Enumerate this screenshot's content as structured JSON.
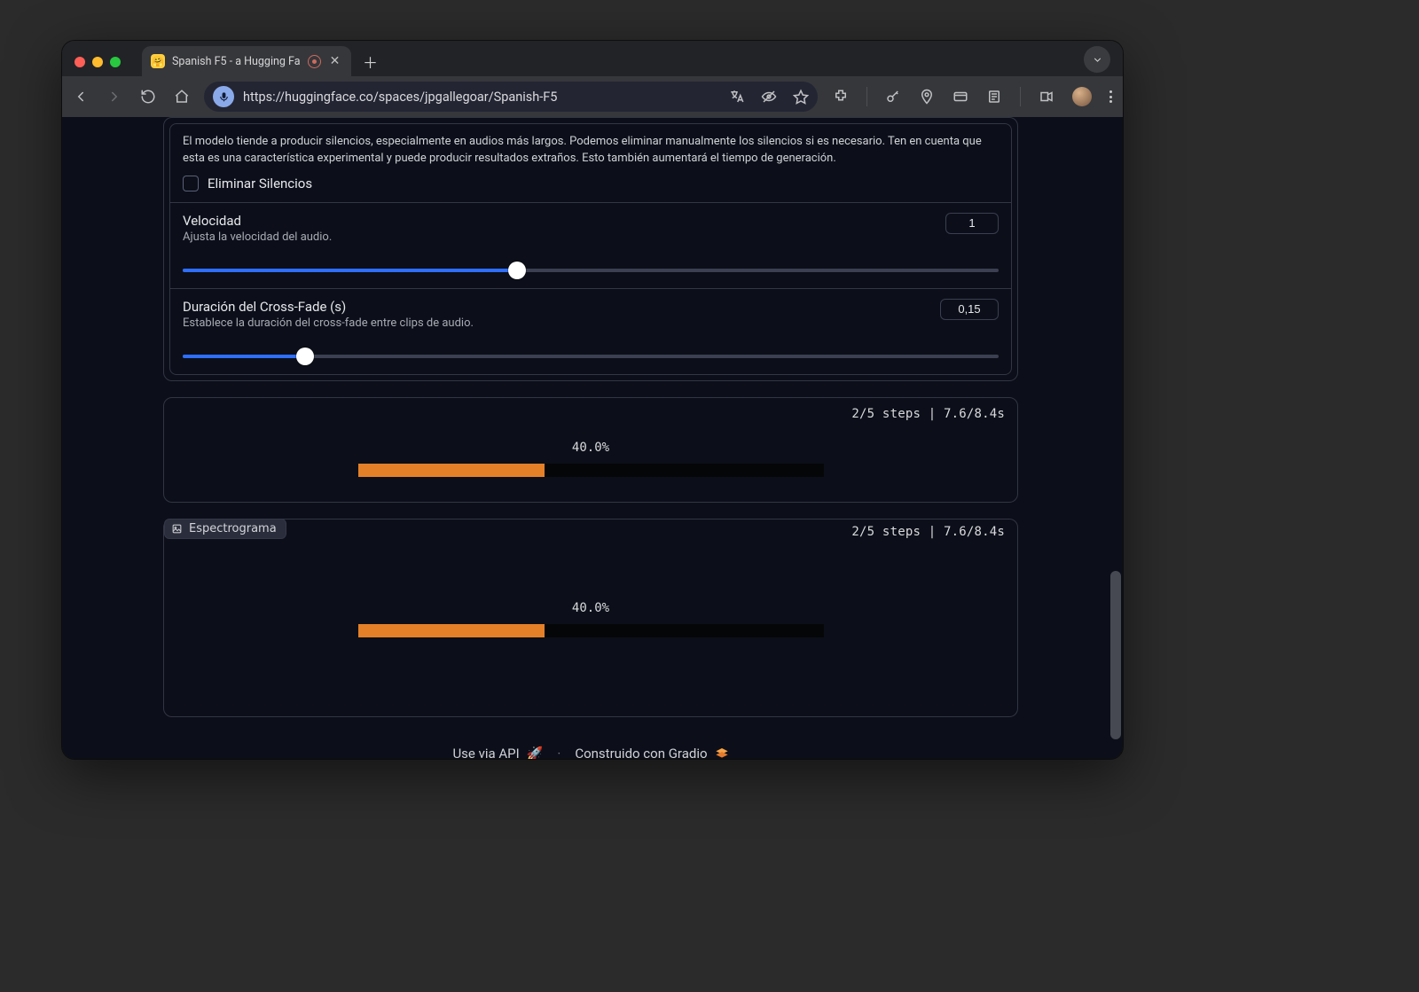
{
  "browser": {
    "tab": {
      "title": "Spanish F5 - a Hugging Fa"
    },
    "url": "https://huggingface.co/spaces/jpgallegoar/Spanish-F5"
  },
  "silences": {
    "description": "El modelo tiende a producir silencios, especialmente en audios más largos. Podemos eliminar manualmente los silencios si es necesario. Ten en cuenta que esta es una característica experimental y puede producir resultados extraños. Esto también aumentará el tiempo de generación.",
    "checkbox_label": "Eliminar Silencios"
  },
  "speed": {
    "label": "Velocidad",
    "sublabel": "Ajusta la velocidad del audio.",
    "value": "1",
    "fill_pct": 41,
    "thumb_pct": 41
  },
  "crossfade": {
    "label": "Duración del Cross-Fade (s)",
    "sublabel": "Establece la duración del cross-fade entre clips de audio.",
    "value": "0,15",
    "fill_pct": 15,
    "thumb_pct": 15
  },
  "progress1": {
    "steps_text": "2/5 steps | 7.6/8.4s",
    "percent_text": "40.0%",
    "fill_pct": 40
  },
  "progress2": {
    "chip_label": "Espectrograma",
    "steps_text": "2/5 steps | 7.6/8.4s",
    "percent_text": "40.0%",
    "fill_pct": 40
  },
  "footer": {
    "api": "Use via API",
    "rocket": "🚀",
    "separator": "·",
    "built_with": "Construido con Gradio"
  }
}
